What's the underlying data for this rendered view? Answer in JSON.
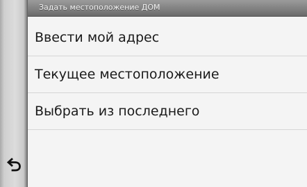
{
  "screen": {
    "title": "Задать местоположение ДОМ",
    "back_icon": "back-arrow-icon"
  },
  "menu": {
    "items": [
      {
        "label": "Ввести мой адрес"
      },
      {
        "label": "Текущее местоположение"
      },
      {
        "label": "Выбрать из последнего"
      }
    ]
  },
  "colors": {
    "titlebar": "#7f7f7f",
    "menu_bg": "#f4f4f4",
    "text": "#1a1a1a",
    "divider": "#d5d5d5"
  }
}
